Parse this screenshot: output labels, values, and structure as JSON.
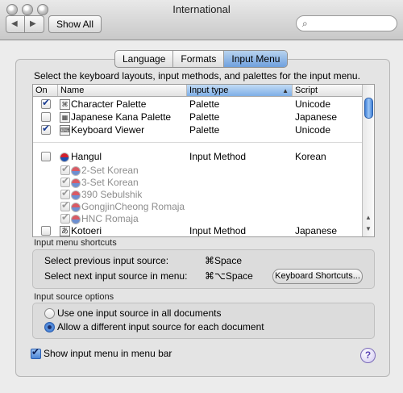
{
  "window": {
    "title": "International"
  },
  "toolbar": {
    "show_all": "Show All",
    "search_placeholder": ""
  },
  "tabs": [
    {
      "label": "Language"
    },
    {
      "label": "Formats"
    },
    {
      "label": "Input Menu",
      "active": true
    }
  ],
  "description": "Select the keyboard layouts, input methods, and palettes for the input menu.",
  "table": {
    "columns": [
      "On",
      "Name",
      "Input type",
      "Script"
    ],
    "rows": [
      {
        "on": true,
        "name": "Character Palette",
        "type": "Palette",
        "script": "Unicode"
      },
      {
        "on": false,
        "name": "Japanese Kana Palette",
        "type": "Palette",
        "script": "Japanese"
      },
      {
        "on": true,
        "name": "Keyboard Viewer",
        "type": "Palette",
        "script": "Unicode"
      },
      {
        "on": false,
        "name": "Hangul",
        "type": "Input Method",
        "script": "Korean"
      },
      {
        "on": true,
        "name": "2-Set Korean",
        "type": "",
        "script": "",
        "dim": true
      },
      {
        "on": true,
        "name": "3-Set Korean",
        "type": "",
        "script": "",
        "dim": true
      },
      {
        "on": true,
        "name": "390 Sebulshik",
        "type": "",
        "script": "",
        "dim": true
      },
      {
        "on": true,
        "name": "GongjinCheong Romaja",
        "type": "",
        "script": "",
        "dim": true
      },
      {
        "on": true,
        "name": "HNC Romaja",
        "type": "",
        "script": "",
        "dim": true
      },
      {
        "on": false,
        "name": "Kotoeri",
        "type": "Input Method",
        "script": "Japanese"
      }
    ],
    "icon_glyphs": {
      "kotoeri": "あ"
    }
  },
  "shortcuts": {
    "section_title": "Input menu shortcuts",
    "prev_label": "Select previous input source:",
    "prev_key": "⌘Space",
    "next_label": "Select next input source in menu:",
    "next_key": "⌘⌥Space",
    "button": "Keyboard Shortcuts..."
  },
  "source_options": {
    "section_title": "Input source options",
    "option1": "Use one input source in all documents",
    "option2": "Allow a different input source for each document",
    "selected": 2
  },
  "show_menu": {
    "label": "Show input menu in menu bar",
    "checked": true
  },
  "colors": {
    "accent": "#6fa0de"
  }
}
